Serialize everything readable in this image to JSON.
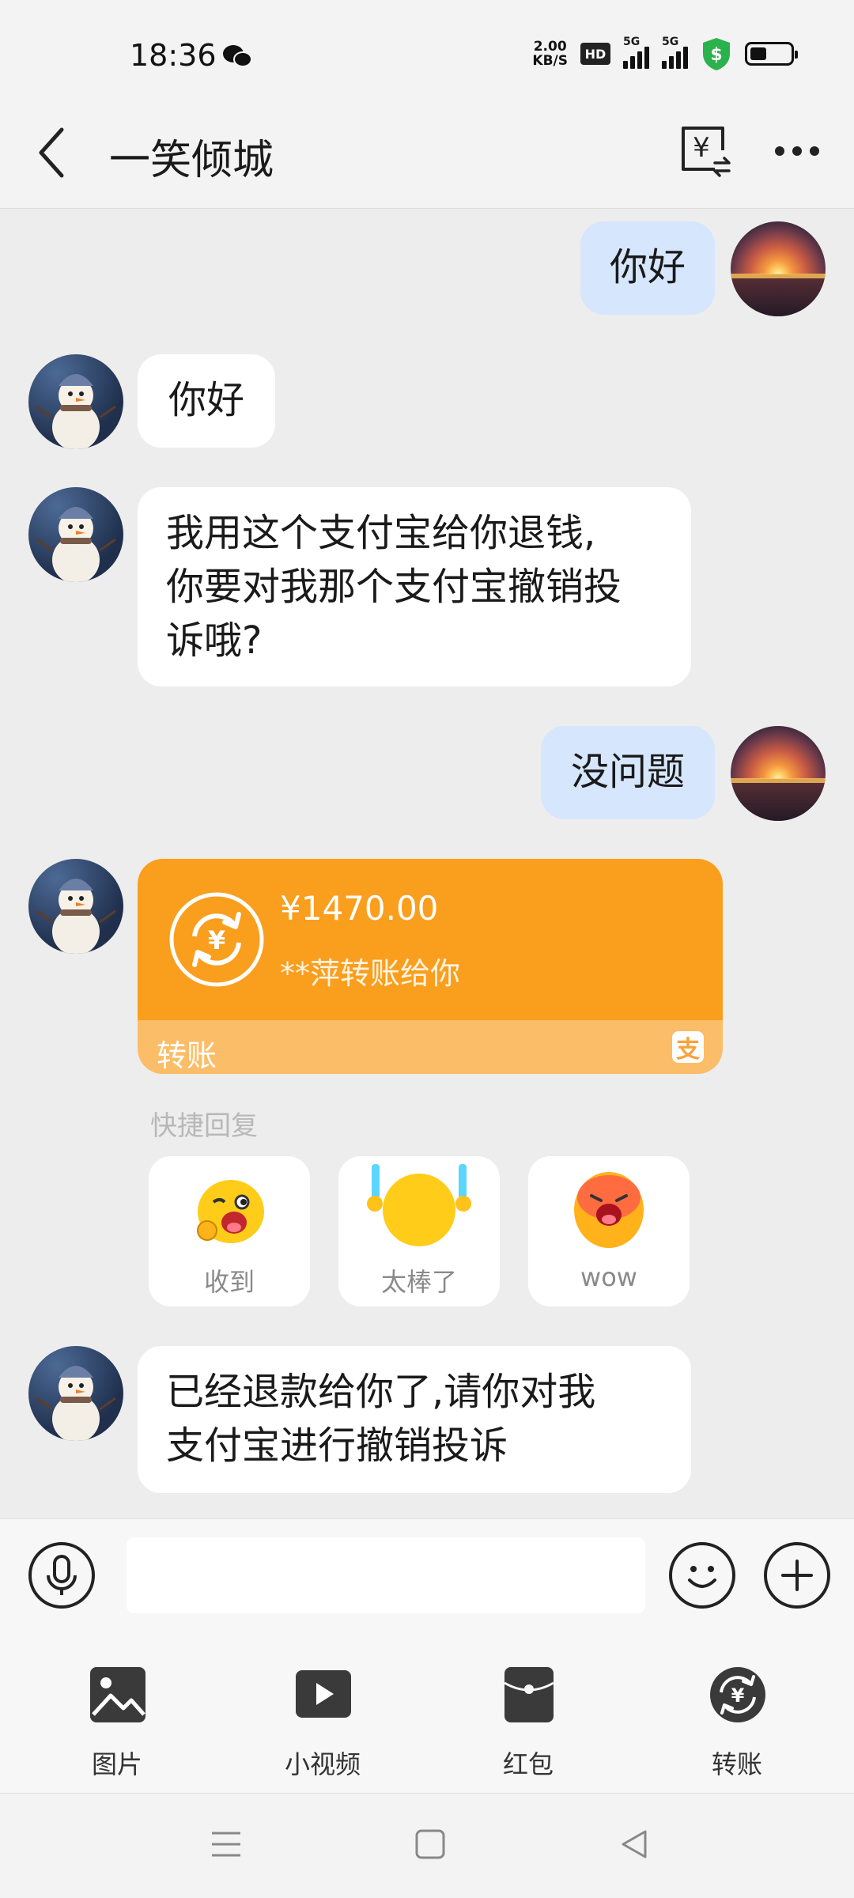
{
  "status_bar": {
    "time": "18:36",
    "speed_value": "2.00",
    "speed_unit": "KB/S",
    "hd_badge": "HD",
    "sim1": "5G",
    "sim2": "5G",
    "icons": [
      "wechat-icon",
      "shield-dollar-icon",
      "battery-icon"
    ]
  },
  "header": {
    "title": "一笑倾城",
    "icons": [
      "back-icon",
      "transfer-icon",
      "more-icon"
    ]
  },
  "messages": [
    {
      "sender": "me",
      "text": "你好"
    },
    {
      "sender": "other",
      "text": "你好"
    },
    {
      "sender": "other",
      "lines": [
        "我用这个支付宝给你退钱,",
        "你要对我那个支付宝撤销投",
        "诉哦?"
      ]
    },
    {
      "sender": "me",
      "text": "没问题"
    },
    {
      "sender": "other",
      "type": "transfer",
      "amount": "¥1470.00",
      "description": "**萍转账给你",
      "label": "转账",
      "badge": "支"
    },
    {
      "sender": "other",
      "lines": [
        "已经退款给你了,请你对我",
        "支付宝进行撤销投诉"
      ]
    }
  ],
  "quick_reply": {
    "label": "快捷回复",
    "options": [
      {
        "label": "收到",
        "emoji": "wink-ok-emoji"
      },
      {
        "label": "太棒了",
        "emoji": "cheer-emoji"
      },
      {
        "label": "wow",
        "emoji": "shout-emoji"
      }
    ]
  },
  "input_bar": {
    "placeholder": "",
    "value": ""
  },
  "tools": [
    {
      "label": "图片",
      "icon": "image-icon"
    },
    {
      "label": "小视频",
      "icon": "video-icon"
    },
    {
      "label": "红包",
      "icon": "red-packet-icon"
    },
    {
      "label": "转账",
      "icon": "transfer-icon"
    }
  ],
  "colors": {
    "my_bubble": "#d6e6fc",
    "other_bubble": "#ffffff",
    "transfer_card": "#fa9e1e",
    "background": "#ededed"
  }
}
